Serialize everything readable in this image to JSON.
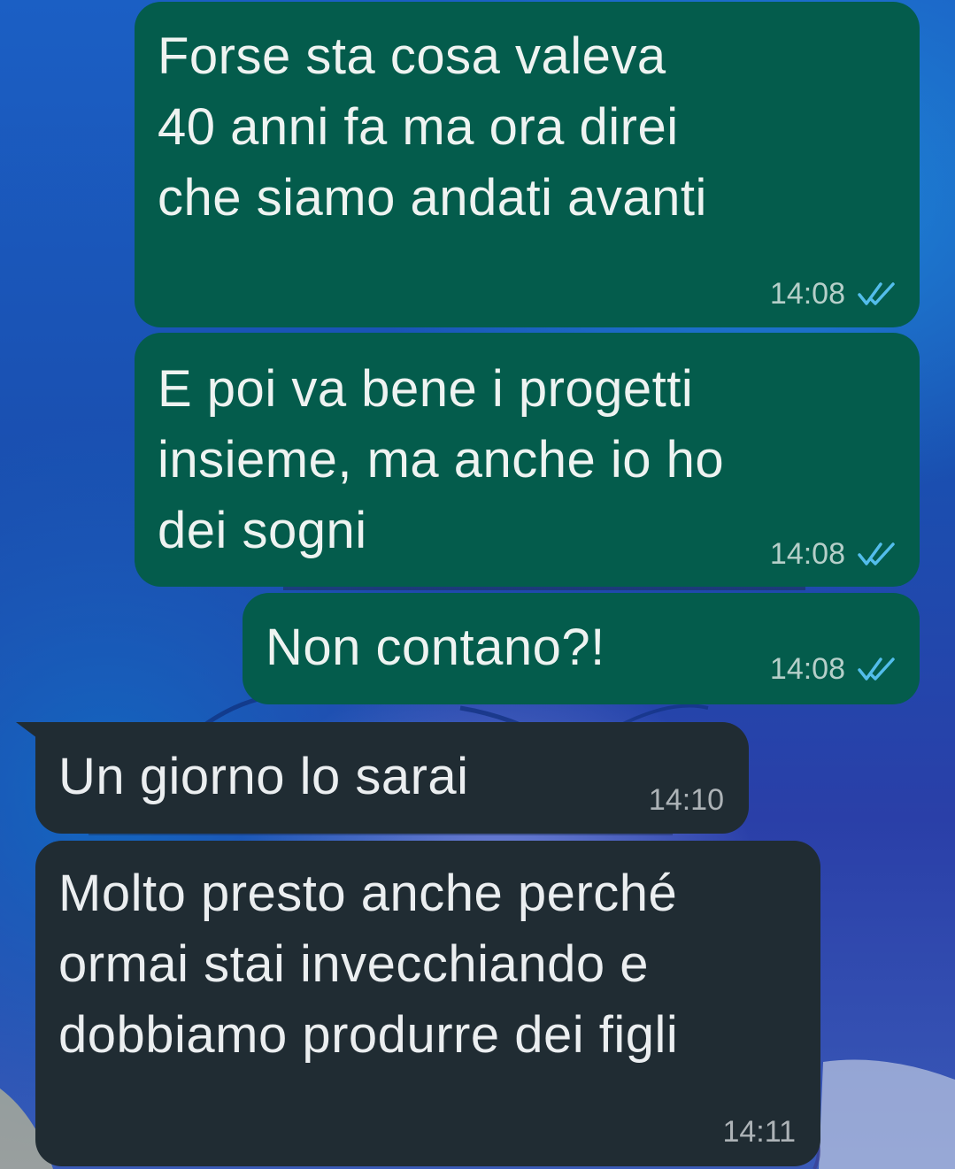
{
  "colors": {
    "outgoing_bubble": "#045c4c",
    "incoming_bubble": "#202c33",
    "read_ticks": "#53bdeb"
  },
  "messages": [
    {
      "direction": "outgoing",
      "text": "Forse sta cosa valeva\n40 anni fa ma ora direi\nche siamo andati avanti",
      "time": "14:08",
      "status": "read",
      "status_icon": "double-check-icon"
    },
    {
      "direction": "outgoing",
      "text": "E poi va bene i progetti\ninsieme, ma anche io ho\ndei sogni",
      "time": "14:08",
      "status": "read",
      "status_icon": "double-check-icon"
    },
    {
      "direction": "outgoing",
      "text": "Non contano?!",
      "time": "14:08",
      "status": "read",
      "status_icon": "double-check-icon"
    },
    {
      "direction": "incoming",
      "text": "Un giorno lo sarai",
      "time": "14:10"
    },
    {
      "direction": "incoming",
      "text": "Molto presto anche perché\normai stai invecchiando e\ndobbiamo produrre dei figli",
      "time": "14:11"
    }
  ]
}
